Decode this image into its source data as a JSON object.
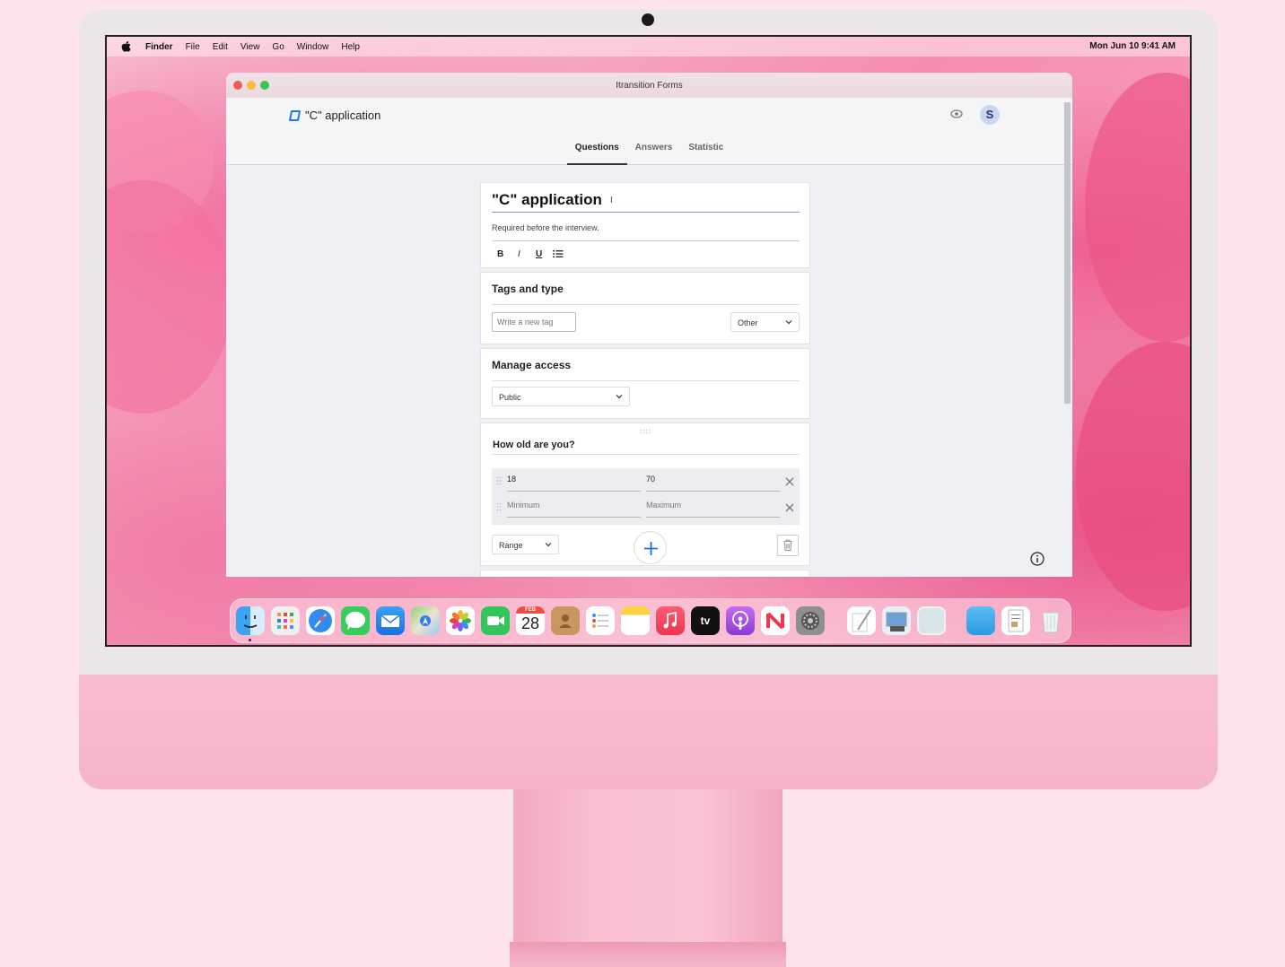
{
  "menubar": {
    "items": [
      "Finder",
      "File",
      "Edit",
      "View",
      "Go",
      "Window",
      "Help"
    ],
    "clock": "Mon Jun 10  9:41 AM"
  },
  "window": {
    "title": "Itransition Forms"
  },
  "app": {
    "form_name": "\"C\" application",
    "avatar_letter": "S",
    "tabs": [
      "Questions",
      "Answers",
      "Statistic"
    ],
    "active_tab": "Questions"
  },
  "form": {
    "title": "\"C\" application",
    "description": "Required before the interview.",
    "format_buttons": {
      "bold": "B",
      "italic": "I",
      "underline": "U"
    }
  },
  "tags_and_type": {
    "heading": "Tags and type",
    "tag_placeholder": "Write a new tag",
    "type_value": "Other"
  },
  "manage_access": {
    "heading": "Manage access",
    "access_value": "Public"
  },
  "question": {
    "title": "How old are you?",
    "rows": [
      {
        "min": "18",
        "max": "70"
      },
      {
        "min": "Minimum",
        "max": "Maximum"
      }
    ],
    "type_value": "Range"
  },
  "dock": {
    "icons": [
      "finder-icon",
      "launchpad-icon",
      "safari-icon",
      "messages-icon",
      "mail-icon",
      "maps-icon",
      "photos-icon",
      "facetime-icon",
      "calendar-icon",
      "contacts-icon",
      "reminders-icon",
      "notes-icon",
      "music-icon",
      "tv-icon",
      "podcasts-icon",
      "news-icon",
      "system-settings-icon",
      "textedit-icon",
      "preview-icon",
      "blank-app-icon",
      "folder-icon",
      "document-icon",
      "trash-icon"
    ],
    "calendar": {
      "month": "FEB",
      "day": "28"
    },
    "tv_label": "tv"
  }
}
